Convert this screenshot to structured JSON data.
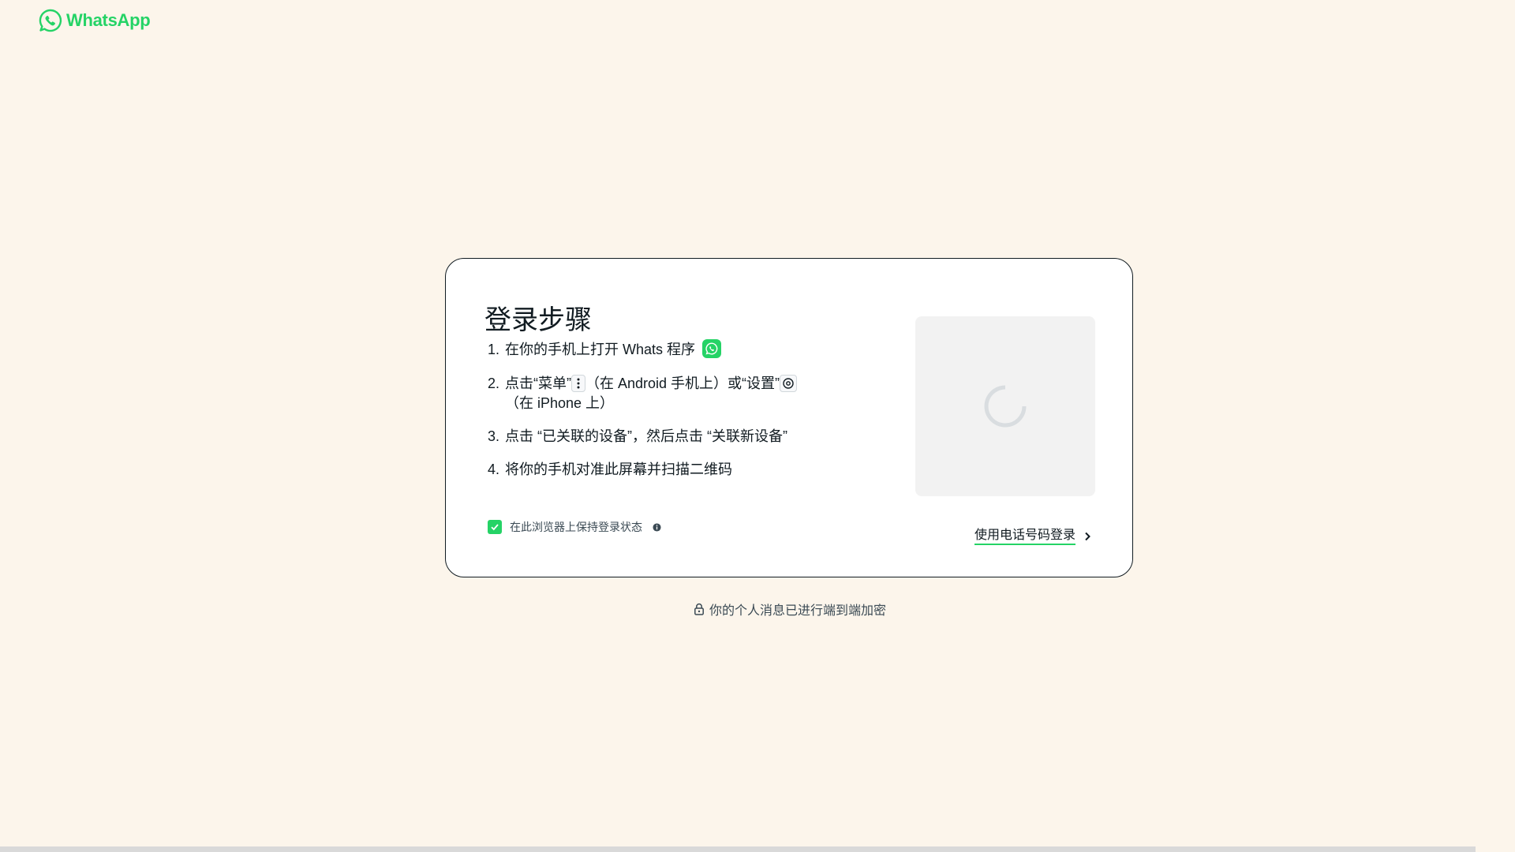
{
  "brand": {
    "name": "WhatsApp",
    "color": "#25d366"
  },
  "card": {
    "title": "登录步骤",
    "steps": [
      {
        "num": "1.",
        "text_a": "在你的手机上打开 Whats 程序"
      },
      {
        "num": "2.",
        "text_a": "点击“菜单”",
        "text_b": "（在 Android 手机上）或“设置”",
        "text_c": "（在 iPhone 上）"
      },
      {
        "num": "3.",
        "text_a": "点击 “已关联的设备”，然后点击 “关联新设备”"
      },
      {
        "num": "4.",
        "text_a": "将你的手机对准此屏幕并扫描二维码"
      }
    ],
    "keep_signed_in": {
      "label": "在此浏览器上保持登录状态",
      "checked": true
    },
    "phone_login_link": "使用电话号码登录"
  },
  "footer": {
    "encryption_note": "你的个人消息已进行端到端加密"
  },
  "icons": {
    "logo": "whatsapp-logo-icon",
    "app_badge": "whatsapp-app-icon",
    "menu": "kebab-menu-icon",
    "settings": "settings-gear-icon",
    "checkbox": "checkmark-icon",
    "info": "info-icon",
    "chevron": "chevron-right-icon",
    "lock": "lock-icon",
    "loading": "loading-spinner-icon"
  }
}
